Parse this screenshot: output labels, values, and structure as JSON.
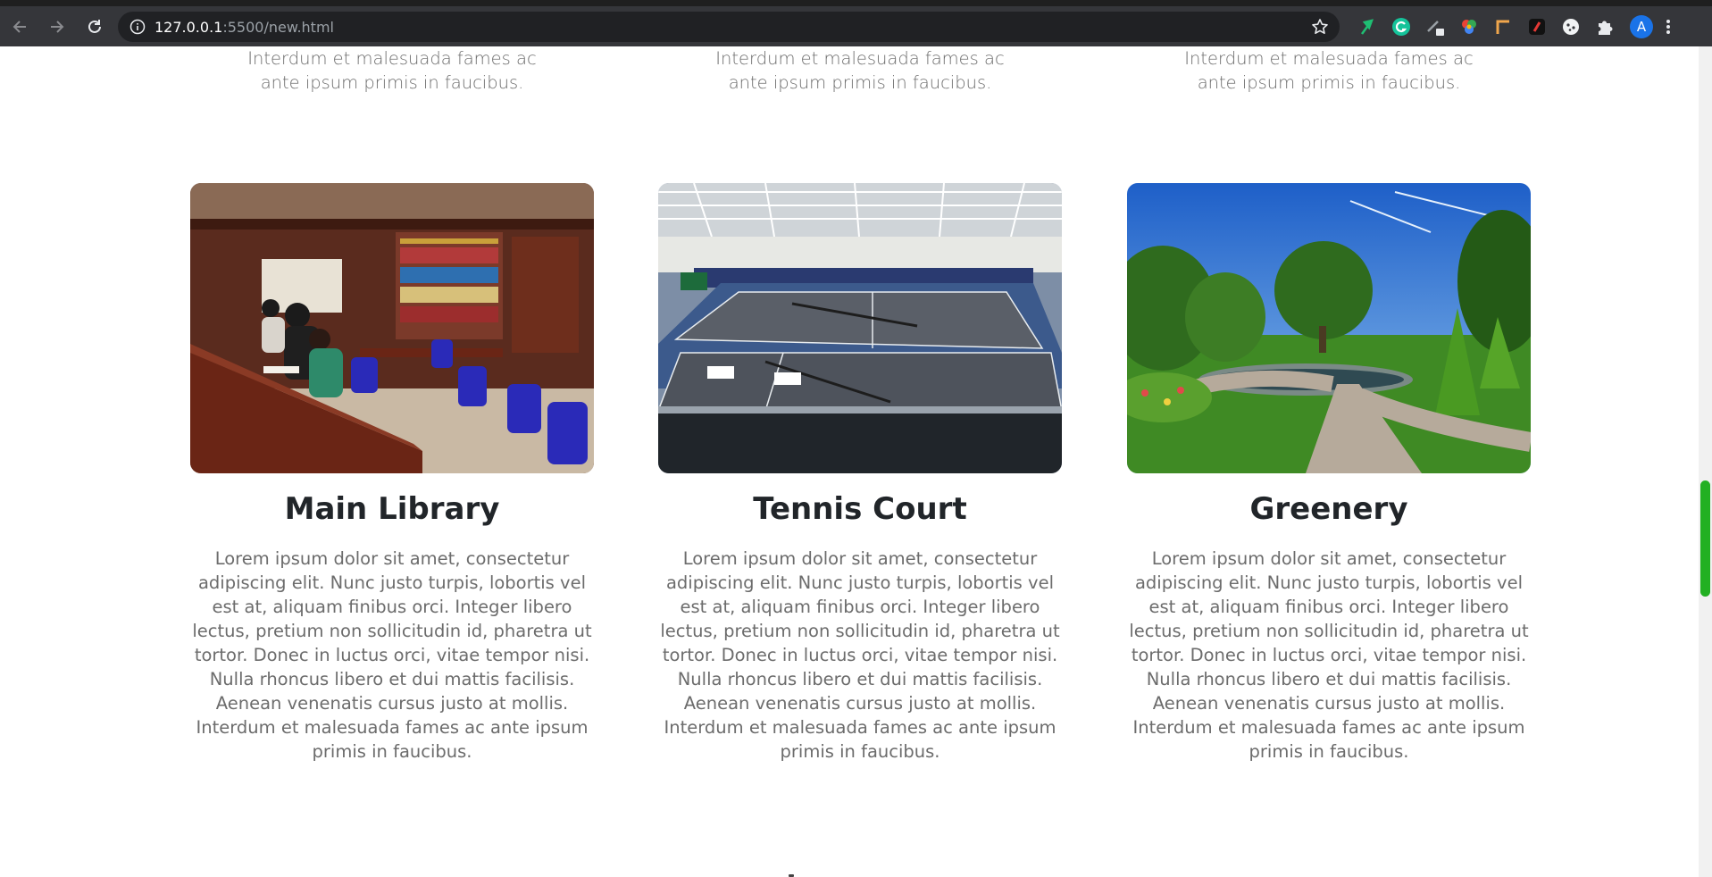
{
  "browser": {
    "url_host": "127.0.0.1",
    "url_path": ":5500/new.html",
    "profile_initial": "A",
    "icons": [
      "back-arrow-icon",
      "forward-arrow-icon",
      "reload-icon",
      "info-icon",
      "star-icon",
      "extension-feather-icon",
      "grammarly-icon",
      "pen-tool-icon",
      "color-picker-icon",
      "ruler-icon",
      "bookmark-extension-icon",
      "cookie-icon",
      "puzzle-icon",
      "kebab-menu-icon"
    ]
  },
  "previous_section": {
    "text_fragment": "Interdum et malesuada fames ac ante ipsum primis in faucibus."
  },
  "facilities": [
    {
      "title": "Main Library",
      "image": "library-photo",
      "description": "Lorem ipsum dolor sit amet, consectetur adipiscing elit. Nunc justo turpis, lobortis vel est at, aliquam finibus orci. Integer libero lectus, pretium non sollicitudin id, pharetra ut tortor. Donec in luctus orci, vitae tempor nisi. Nulla rhoncus libero et dui mattis facilisis. Aenean venenatis cursus justo at mollis. Interdum et malesuada fames ac ante ipsum primis in faucibus."
    },
    {
      "title": "Tennis Court",
      "image": "tennis-court-photo",
      "description": "Lorem ipsum dolor sit amet, consectetur adipiscing elit. Nunc justo turpis, lobortis vel est at, aliquam finibus orci. Integer libero lectus, pretium non sollicitudin id, pharetra ut tortor. Donec in luctus orci, vitae tempor nisi. Nulla rhoncus libero et dui mattis facilisis. Aenean venenatis cursus justo at mollis. Interdum et malesuada fames ac ante ipsum primis in faucibus."
    },
    {
      "title": "Greenery",
      "image": "greenery-photo",
      "description": "Lorem ipsum dolor sit amet, consectetur adipiscing elit. Nunc justo turpis, lobortis vel est at, aliquam finibus orci. Integer libero lectus, pretium non sollicitudin id, pharetra ut tortor. Donec in luctus orci, vitae tempor nisi. Nulla rhoncus libero et dui mattis facilisis. Aenean venenatis cursus justo at mollis. Interdum et malesuada fames ac ante ipsum primis in faucibus."
    }
  ],
  "colors": {
    "chrome_bg": "#35363a",
    "omnibox_bg": "#202124",
    "heading": "#212529",
    "body_text": "#6c6c6c",
    "scroll_thumb": "#22b022"
  }
}
